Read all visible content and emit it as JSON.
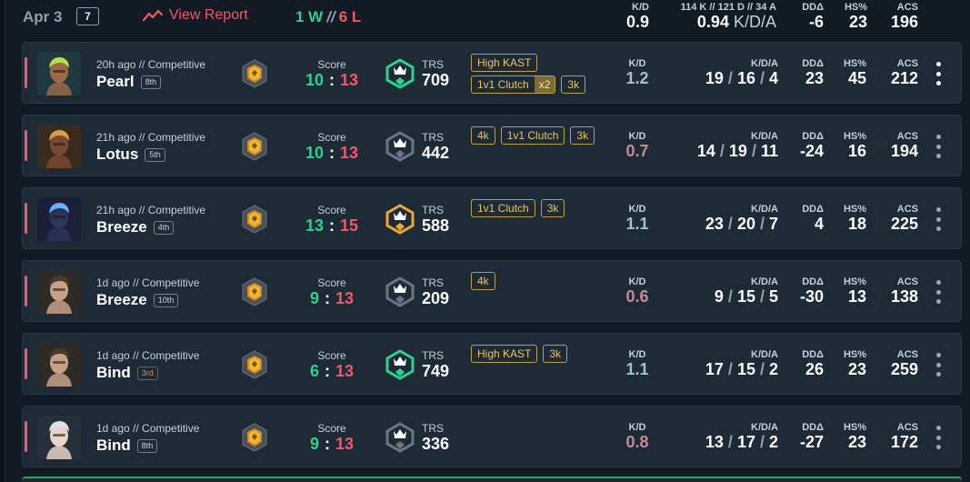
{
  "header": {
    "date": "Apr 3",
    "match_count": "7",
    "view_report_label": "View Report",
    "wins": "1 W",
    "separator": "//",
    "losses": "6 L",
    "summary": {
      "kd_label": "K/D",
      "kd_value": "0.9",
      "totals_line": "114 K // 121 D // 34 A",
      "kda_value": "0.94",
      "kda_suffix": "K/D/A",
      "dd_label": "DDΔ",
      "dd_value": "-6",
      "hs_label": "HS%",
      "hs_value": "23",
      "acs_label": "ACS",
      "acs_value": "196"
    }
  },
  "labels": {
    "score": "Score",
    "trs": "TRS",
    "kd": "K/D",
    "kda": "K/D/A",
    "dd": "DDΔ",
    "hs": "HS%",
    "acs": "ACS",
    "slash": "/",
    "colon": ":"
  },
  "matches": [
    {
      "time": "20h ago // Competitive",
      "map": "Pearl",
      "place": "8th",
      "place_color": "gray",
      "agent_icon": "agent-neon-icon",
      "score_won": "10",
      "score_lost": "13",
      "trs": "709",
      "trs_color": "green",
      "badges": [
        {
          "text": "High KAST",
          "extra": ""
        },
        {
          "text": "1v1 Clutch",
          "extra": "x2"
        },
        {
          "text": "3k",
          "extra": ""
        }
      ],
      "kd": "1.2",
      "kd_quality": "good",
      "kills": "19",
      "deaths": "16",
      "assists": "4",
      "dd": "23",
      "hs": "45",
      "acs": "212"
    },
    {
      "time": "21h ago // Competitive",
      "map": "Lotus",
      "place": "5th",
      "place_color": "gray",
      "agent_icon": "agent-phoenix-icon",
      "score_won": "10",
      "score_lost": "13",
      "trs": "442",
      "trs_color": "gray",
      "badges": [
        {
          "text": "4k",
          "extra": ""
        },
        {
          "text": "1v1 Clutch",
          "extra": ""
        },
        {
          "text": "3k",
          "extra": ""
        }
      ],
      "kd": "0.7",
      "kd_quality": "bad",
      "kills": "14",
      "deaths": "19",
      "assists": "11",
      "dd": "-24",
      "hs": "16",
      "acs": "194"
    },
    {
      "time": "21h ago // Competitive",
      "map": "Breeze",
      "place": "4th",
      "place_color": "gray",
      "agent_icon": "agent-omen-icon",
      "score_won": "13",
      "score_lost": "15",
      "trs": "588",
      "trs_color": "gold",
      "badges": [
        {
          "text": "1v1 Clutch",
          "extra": ""
        },
        {
          "text": "3k",
          "extra": ""
        }
      ],
      "kd": "1.1",
      "kd_quality": "good",
      "kills": "23",
      "deaths": "20",
      "assists": "7",
      "dd": "4",
      "hs": "18",
      "acs": "225"
    },
    {
      "time": "1d ago // Competitive",
      "map": "Breeze",
      "place": "10th",
      "place_color": "gray",
      "agent_icon": "agent-chamber-icon",
      "score_won": "9",
      "score_lost": "13",
      "trs": "209",
      "trs_color": "gray",
      "badges": [
        {
          "text": "4k",
          "extra": ""
        }
      ],
      "kd": "0.6",
      "kd_quality": "bad",
      "kills": "9",
      "deaths": "15",
      "assists": "5",
      "dd": "-30",
      "hs": "13",
      "acs": "138"
    },
    {
      "time": "1d ago // Competitive",
      "map": "Bind",
      "place": "3rd",
      "place_color": "orange",
      "agent_icon": "agent-chamber-icon",
      "score_won": "6",
      "score_lost": "13",
      "trs": "749",
      "trs_color": "green",
      "badges": [
        {
          "text": "High KAST",
          "extra": ""
        },
        {
          "text": "3k",
          "extra": ""
        }
      ],
      "kd": "1.1",
      "kd_quality": "good",
      "kills": "17",
      "deaths": "15",
      "assists": "2",
      "dd": "26",
      "hs": "23",
      "acs": "259"
    },
    {
      "time": "1d ago // Competitive",
      "map": "Bind",
      "place": "8th",
      "place_color": "gray",
      "agent_icon": "agent-jett-icon",
      "score_won": "9",
      "score_lost": "13",
      "trs": "336",
      "trs_color": "gray",
      "badges": [],
      "kd": "0.8",
      "kd_quality": "bad",
      "kills": "13",
      "deaths": "17",
      "assists": "2",
      "dd": "-27",
      "hs": "23",
      "acs": "172"
    }
  ],
  "colors": {
    "win": "#2fd18f",
    "loss": "#f4566a",
    "badge": "#e7c56a",
    "background": "#121a23",
    "row": "#1e2a36"
  }
}
